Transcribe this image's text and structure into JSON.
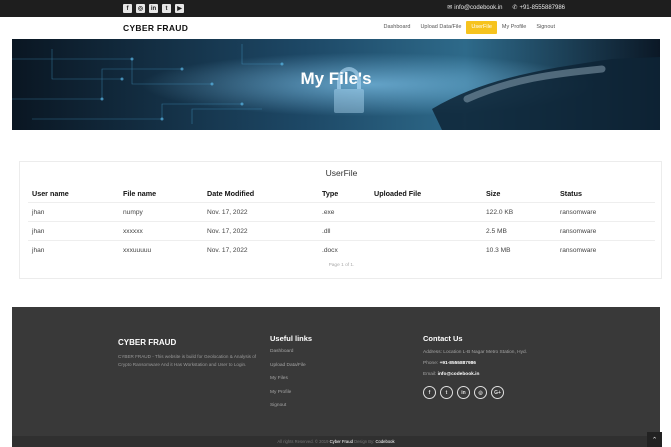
{
  "topbar": {
    "social_icons": [
      "facebook-icon",
      "instagram-icon",
      "linkedin-icon",
      "twitter-icon",
      "youtube-icon"
    ],
    "social_glyphs": [
      "f",
      "◎",
      "in",
      "t",
      "▶"
    ],
    "email": "info@codebook.in",
    "phone": "+91-8555887986"
  },
  "navbar": {
    "brand": "CYBER FRAUD",
    "items": [
      {
        "label": "Dashboard",
        "active": false
      },
      {
        "label": "Upload Data/File",
        "active": false
      },
      {
        "label": "UserFile",
        "active": true
      },
      {
        "label": "My Profile",
        "active": false
      },
      {
        "label": "Signout",
        "active": false
      }
    ]
  },
  "hero": {
    "title": "My File's"
  },
  "table": {
    "title": "UserFile",
    "headers": [
      "User name",
      "File name",
      "Date Modified",
      "Type",
      "Uploaded File",
      "Size",
      "Status"
    ],
    "rows": [
      [
        "jhan",
        "numpy",
        "Nov. 17, 2022",
        ".exe",
        "",
        "122.0 KB",
        "ransomware"
      ],
      [
        "jhan",
        "xxxxxx",
        "Nov. 17, 2022",
        ".dll",
        "",
        "2.5 MB",
        "ransomware"
      ],
      [
        "jhan",
        "xxxuuuuu",
        "Nov. 17, 2022",
        ".docx",
        "",
        "10.3 MB",
        "ransomware"
      ]
    ],
    "pagination": "Page 1 of 1."
  },
  "footer": {
    "brand": "CYBER FRAUD",
    "description": "CYBER FRAUD - This website is build for Geolocation & Analysis of Crypto Ransomware And it Has Workstation and User to Login.",
    "links_heading": "Useful links",
    "links": [
      "Dashboard",
      "Upload Data/File",
      "My Files",
      "My Profile",
      "Signout"
    ],
    "contact_heading": "Contact Us",
    "address_label": "Address:",
    "address": "Location L-B Nagar Metro Station, Hyd.",
    "phone_label": "Phone:",
    "phone": "+91-8555887986",
    "email_label": "Email:",
    "email": "info@codebook.in",
    "social_icons": [
      "facebook-icon",
      "twitter-icon",
      "linkedin-icon",
      "instagram-icon",
      "google-plus-icon"
    ],
    "social_glyphs": [
      "f",
      "t",
      "in",
      "◎",
      "G+"
    ],
    "copyright_prefix": "All rights Reserved. © 2019",
    "copyright_brand": "Cyber Fraud",
    "copyright_mid": "Design By:",
    "copyright_designer": "Codebook"
  },
  "colors": {
    "accent": "#f6c31e",
    "footer_bg": "#393939",
    "topbar_bg": "#1e1e1e"
  }
}
